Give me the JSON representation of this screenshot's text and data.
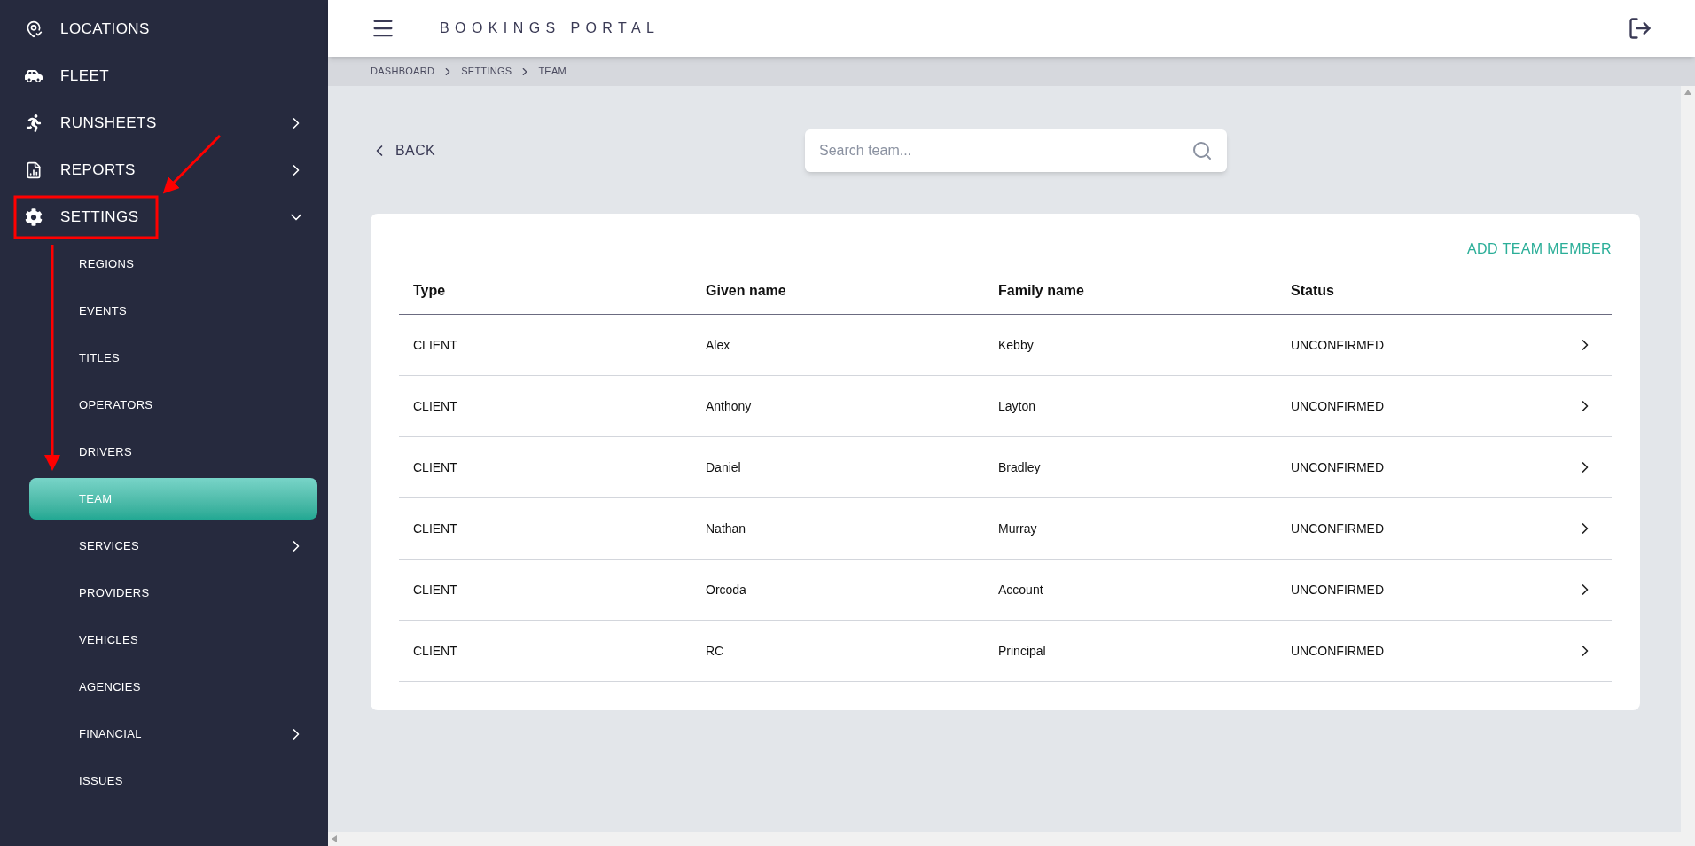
{
  "sidebar": {
    "items": [
      {
        "label": "LOCATIONS",
        "kind": "link"
      },
      {
        "label": "FLEET",
        "kind": "link"
      },
      {
        "label": "RUNSHEETS",
        "kind": "group",
        "expanded": false
      },
      {
        "label": "REPORTS",
        "kind": "group",
        "expanded": false
      },
      {
        "label": "SETTINGS",
        "kind": "group",
        "expanded": true,
        "children": [
          {
            "label": "REGIONS",
            "kind": "link",
            "selected": false
          },
          {
            "label": "EVENTS",
            "kind": "link",
            "selected": false
          },
          {
            "label": "TITLES",
            "kind": "link",
            "selected": false
          },
          {
            "label": "OPERATORS",
            "kind": "link",
            "selected": false
          },
          {
            "label": "DRIVERS",
            "kind": "link",
            "selected": false
          },
          {
            "label": "TEAM",
            "kind": "link",
            "selected": true
          },
          {
            "label": "SERVICES",
            "kind": "group",
            "expanded": false,
            "selected": false
          },
          {
            "label": "PROVIDERS",
            "kind": "link",
            "selected": false
          },
          {
            "label": "VEHICLES",
            "kind": "link",
            "selected": false
          },
          {
            "label": "AGENCIES",
            "kind": "link",
            "selected": false
          },
          {
            "label": "FINANCIAL",
            "kind": "group",
            "expanded": false,
            "selected": false
          },
          {
            "label": "ISSUES",
            "kind": "link",
            "selected": false
          }
        ]
      }
    ]
  },
  "header": {
    "title": "BOOKINGS PORTAL"
  },
  "breadcrumb": [
    "DASHBOARD",
    "SETTINGS",
    "TEAM"
  ],
  "back": "BACK",
  "search": {
    "placeholder": "Search team..."
  },
  "add_button": "ADD TEAM MEMBER",
  "table": {
    "columns": [
      "Type",
      "Given name",
      "Family name",
      "Status"
    ],
    "rows": [
      [
        "CLIENT",
        "Alex",
        "Kebby",
        "UNCONFIRMED"
      ],
      [
        "CLIENT",
        "Anthony",
        "Layton",
        "UNCONFIRMED"
      ],
      [
        "CLIENT",
        "Daniel",
        "Bradley",
        "UNCONFIRMED"
      ],
      [
        "CLIENT",
        "Nathan",
        "Murray",
        "UNCONFIRMED"
      ],
      [
        "CLIENT",
        "Orcoda",
        "Account",
        "UNCONFIRMED"
      ],
      [
        "CLIENT",
        "RC",
        "Principal",
        "UNCONFIRMED"
      ]
    ]
  }
}
